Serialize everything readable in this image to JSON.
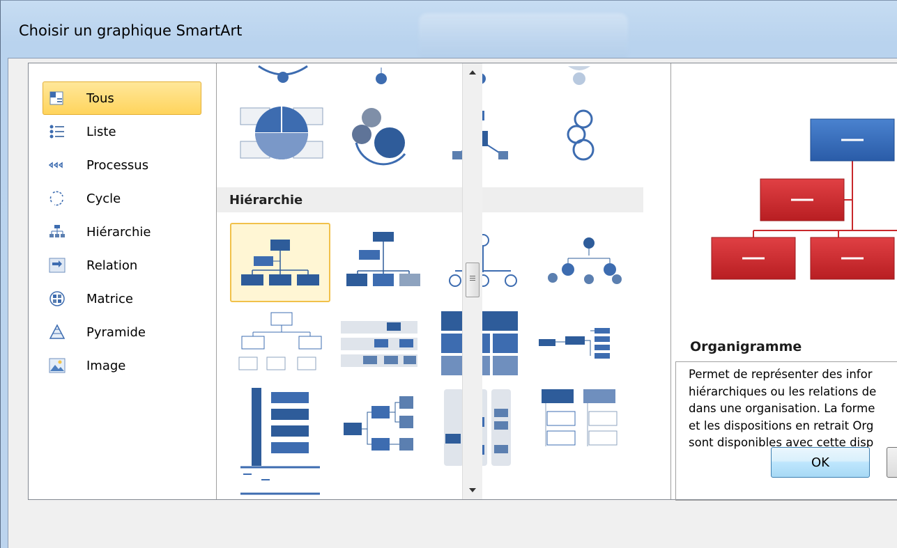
{
  "window": {
    "title": "Choisir un graphique SmartArt"
  },
  "categories": [
    {
      "label": "Tous",
      "icon": "all-icon",
      "selected": true
    },
    {
      "label": "Liste",
      "icon": "list-icon",
      "selected": false
    },
    {
      "label": "Processus",
      "icon": "process-icon",
      "selected": false
    },
    {
      "label": "Cycle",
      "icon": "cycle-icon",
      "selected": false
    },
    {
      "label": "Hiérarchie",
      "icon": "hierarchy-icon",
      "selected": false
    },
    {
      "label": "Relation",
      "icon": "relation-icon",
      "selected": false
    },
    {
      "label": "Matrice",
      "icon": "matrix-icon",
      "selected": false
    },
    {
      "label": "Pyramide",
      "icon": "pyramid-icon",
      "selected": false
    },
    {
      "label": "Image",
      "icon": "image-icon",
      "selected": false
    }
  ],
  "gallery": {
    "section_label": "Hiérarchie",
    "selected_layout": "organigramme"
  },
  "preview": {
    "title": "Organigramme",
    "description_lines": [
      "Permet de représenter des infor",
      "hiérarchiques ou les relations de",
      "dans une organisation. La forme",
      "et les dispositions en retrait Org",
      "sont disponibles avec cette disp"
    ]
  },
  "buttons": {
    "ok": "OK"
  },
  "colors": {
    "accent": "#2e5c9a",
    "preview_top": "#2e67b5",
    "preview_nodes": "#c8282b",
    "selection": "#f1c14a"
  }
}
